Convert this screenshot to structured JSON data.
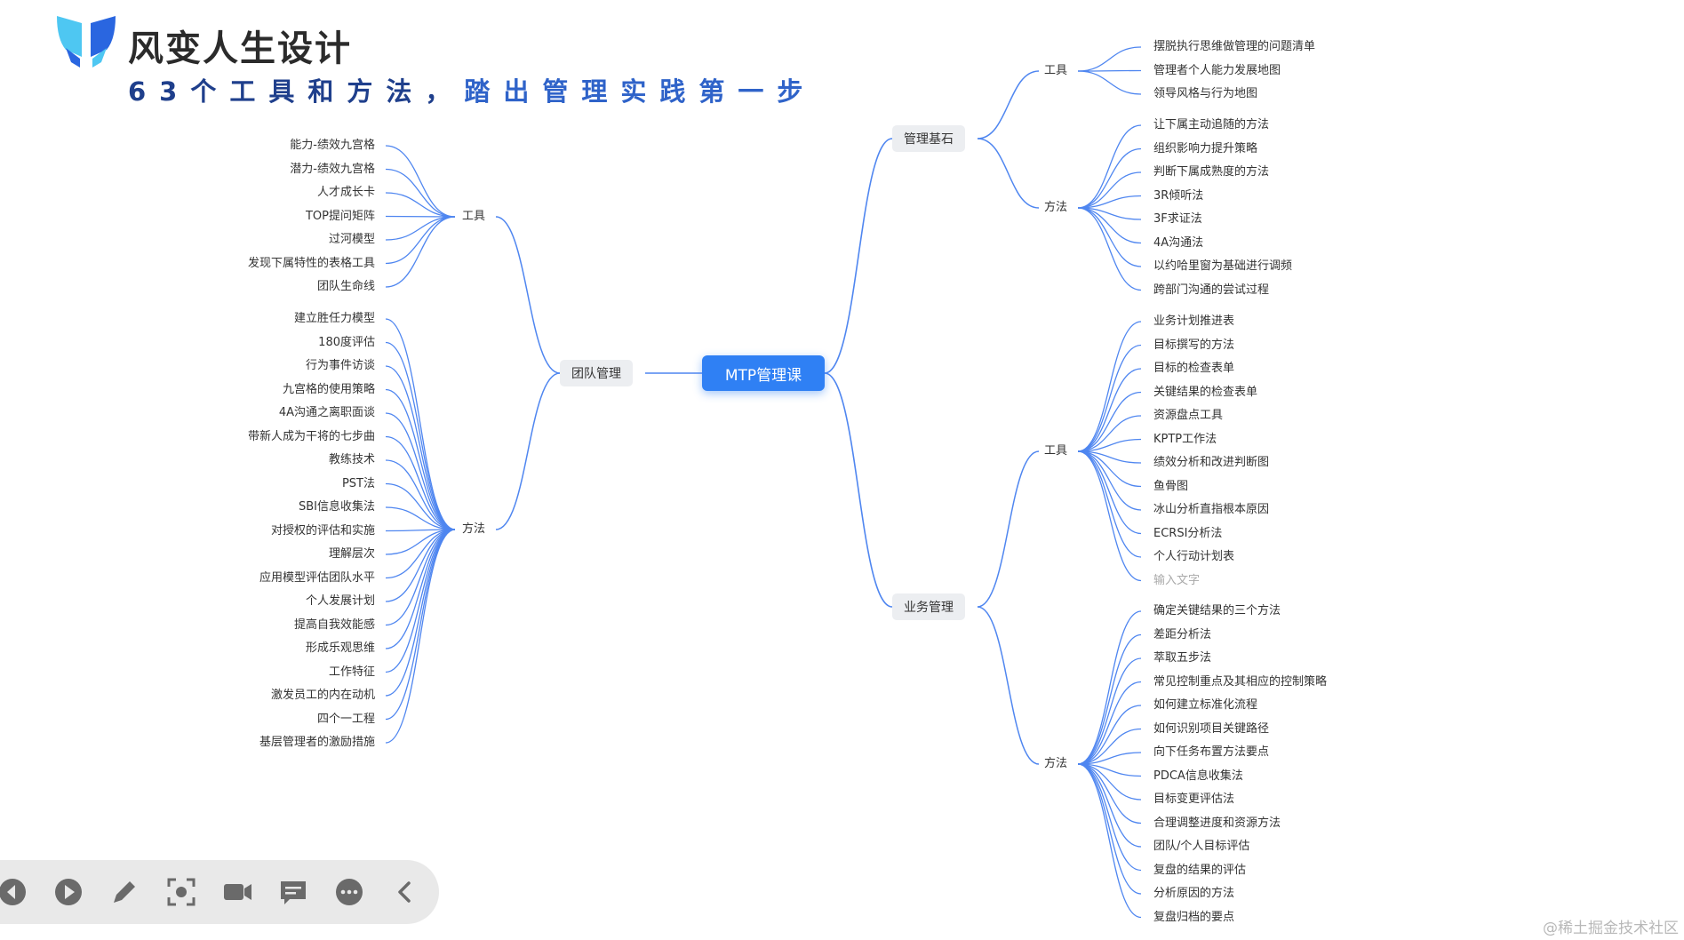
{
  "header": {
    "brand_name": "风变人生设计",
    "slogan_part1": "63个工具和方法，",
    "slogan_part2": "踏出管理实践第一步"
  },
  "colors": {
    "connector": "#4f86f0",
    "root_fill": "#2f80f4",
    "branch_fill": "#eceef1",
    "logo_light": "#4ec7f2",
    "logo_dark": "#2a66e0"
  },
  "mindmap": {
    "root": "MTP管理课",
    "branches": [
      {
        "label": "团队管理",
        "side": "left",
        "groups": [
          {
            "label": "工具",
            "items": [
              "能力-绩效九宫格",
              "潜力-绩效九宫格",
              "人才成长卡",
              "TOP提问矩阵",
              "过河模型",
              "发现下属特性的表格工具",
              "团队生命线"
            ]
          },
          {
            "label": "方法",
            "items": [
              "建立胜任力模型",
              "180度评估",
              "行为事件访谈",
              "九宫格的使用策略",
              "4A沟通之离职面谈",
              "带新人成为干将的七步曲",
              "教练技术",
              "PST法",
              "SBI信息收集法",
              "对授权的评估和实施",
              "理解层次",
              "应用模型评估团队水平",
              "个人发展计划",
              "提高自我效能感",
              "形成乐观思维",
              "工作特征",
              "激发员工的内在动机",
              "四个一工程",
              "基层管理者的激励措施"
            ]
          }
        ]
      },
      {
        "label": "管理基石",
        "side": "right",
        "groups": [
          {
            "label": "工具",
            "items": [
              "摆脱执行思维做管理的问题清单",
              "管理者个人能力发展地图",
              "领导风格与行为地图"
            ]
          },
          {
            "label": "方法",
            "items": [
              "让下属主动追随的方法",
              "组织影响力提升策略",
              "判断下属成熟度的方法",
              "3R倾听法",
              "3F求证法",
              "4A沟通法",
              "以约哈里窗为基础进行调频",
              "跨部门沟通的尝试过程"
            ]
          }
        ]
      },
      {
        "label": "业务管理",
        "side": "right",
        "groups": [
          {
            "label": "工具",
            "items": [
              "业务计划推进表",
              "目标撰写的方法",
              "目标的检查表单",
              "关键结果的检查表单",
              "资源盘点工具",
              "KPTP工作法",
              "绩效分析和改进判断图",
              "鱼骨图",
              "冰山分析直指根本原因",
              "ECRSI分析法",
              "个人行动计划表",
              "输入文字"
            ]
          },
          {
            "label": "方法",
            "items": [
              "确定关键结果的三个方法",
              "差距分析法",
              "萃取五步法",
              "常见控制重点及其相应的控制策略",
              "如何建立标准化流程",
              "如何识别项目关键路径",
              "向下任务布置方法要点",
              "PDCA信息收集法",
              "目标变更评估法",
              "合理调整进度和资源方法",
              "团队/个人目标评估",
              "复盘的结果的评估",
              "分析原因的方法",
              "复盘归档的要点"
            ]
          }
        ]
      }
    ]
  },
  "toolbar": {
    "buttons": [
      {
        "icon": "previous-icon"
      },
      {
        "icon": "play-icon"
      },
      {
        "icon": "pen-icon"
      },
      {
        "icon": "screenshot-icon"
      },
      {
        "icon": "camera-icon"
      },
      {
        "icon": "comment-icon"
      },
      {
        "icon": "more-icon"
      },
      {
        "icon": "collapse-icon"
      }
    ]
  },
  "watermark": "@稀土掘金技术社区"
}
